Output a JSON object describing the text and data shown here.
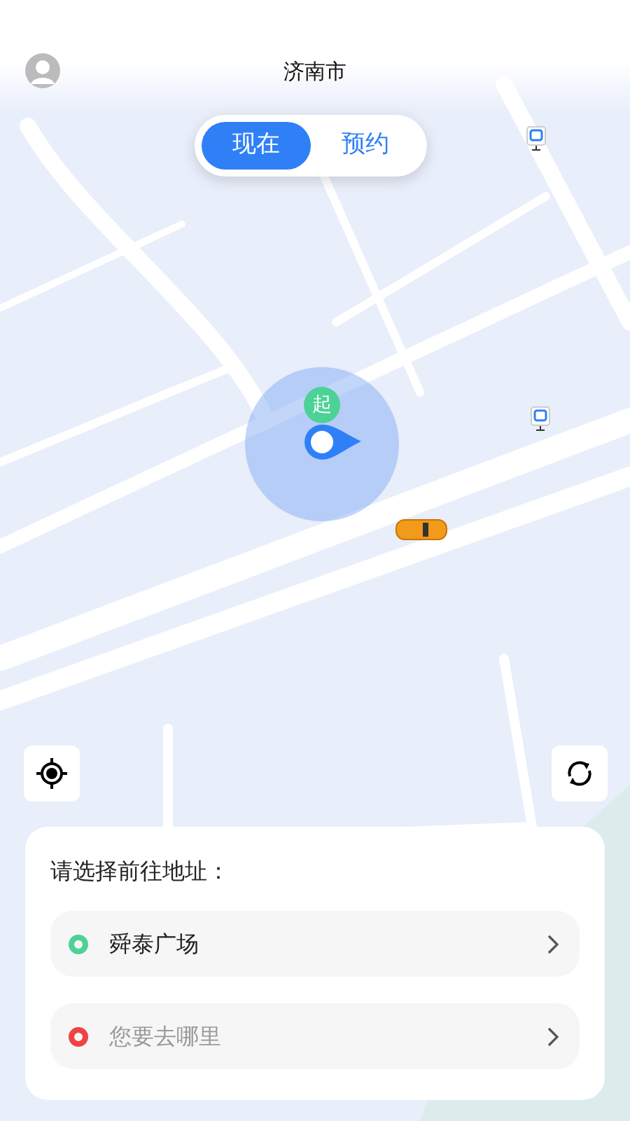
{
  "header": {
    "city": "济南市"
  },
  "mode_tabs": [
    {
      "label": "现在",
      "selected": true
    },
    {
      "label": "预约",
      "selected": false
    }
  ],
  "map": {
    "start_marker": "起"
  },
  "address_card": {
    "title": "请选择前往地址：",
    "rows": [
      {
        "text": "舜泰广场",
        "color": "#4cd295",
        "empty": false
      },
      {
        "text": "您要去哪里",
        "color": "#ef4444",
        "empty": true
      }
    ]
  }
}
